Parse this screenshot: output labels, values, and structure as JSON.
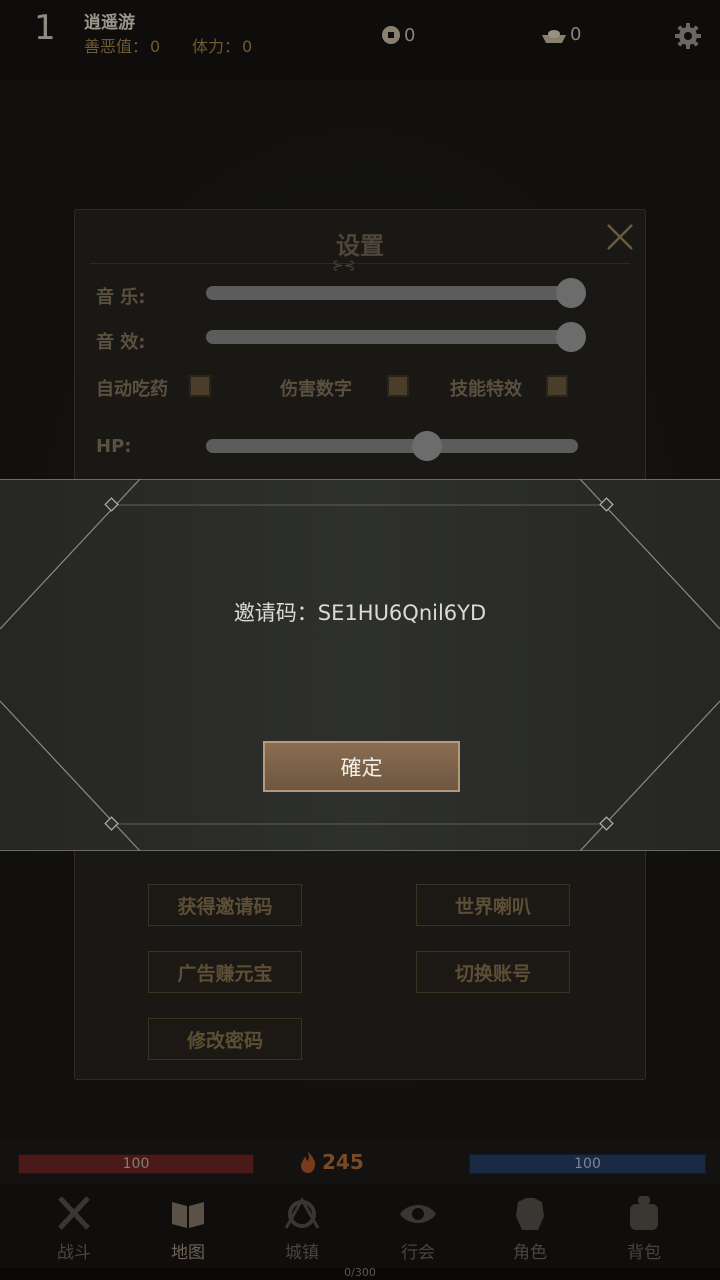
{
  "header": {
    "level": "1",
    "player_name": "逍遥游",
    "karma_label": "善恶值：",
    "karma_value": "0",
    "stamina_label": "体力：",
    "stamina_value": "0",
    "coin_value": "0",
    "ingot_value": "0"
  },
  "settings": {
    "title": "设置",
    "music_label": "音  乐:",
    "music_level": 1.0,
    "sfx_label": "音  效:",
    "sfx_level": 1.0,
    "auto_potion_label": "自动吃药",
    "damage_numbers_label": "伤害数字",
    "skill_effects_label": "技能特效",
    "hp_label": "HP:",
    "hp_threshold": 0.6,
    "buttons": {
      "get_invite": "获得邀请码",
      "world_horn": "世界喇叭",
      "ad_ingot": "广告赚元宝",
      "switch_account": "切换账号",
      "change_password": "修改密码"
    }
  },
  "dialog": {
    "invite_text": "邀请码：SE1HU6Qnil6YD",
    "ok_label": "確定"
  },
  "status": {
    "hp_value": "100",
    "mp_value": "100",
    "power": "245"
  },
  "nav": {
    "battle": "战斗",
    "map": "地图",
    "town": "城镇",
    "guild": "行会",
    "character": "角色",
    "bag": "背包"
  },
  "xp": "0/300",
  "colors": {
    "accent_gold": "#b49a78",
    "button_brown": "#7a6048",
    "hp_red": "#4a1a18",
    "mp_blue": "#1a2a44"
  }
}
